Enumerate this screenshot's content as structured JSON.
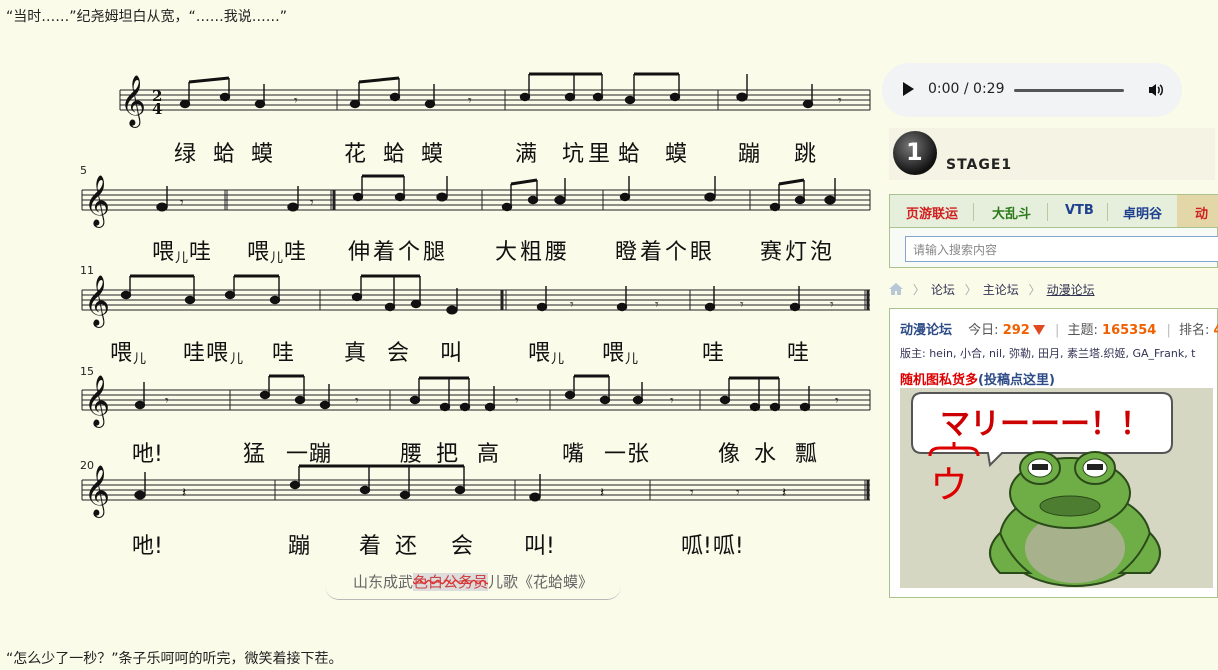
{
  "text": {
    "top_paragraph": "“当时……”纪尧姆坦白从宽，“……我说……”",
    "bottom_paragraph": "“怎么少了一秒？”条子乐呵呵的听完，微笑着接下茬。"
  },
  "score": {
    "time_signature_top": "2",
    "time_signature_bottom": "4",
    "measure_numbers": [
      "5",
      "11",
      "15",
      "20"
    ],
    "lyrics": {
      "row1": [
        "绿",
        "蛤",
        "蟆",
        "花",
        "蛤",
        "蟆",
        "满",
        "坑",
        "里",
        "蛤",
        "蟆",
        "蹦",
        "跳"
      ],
      "row2": [
        "喂",
        "儿",
        "哇",
        "喂",
        "儿",
        "哇",
        "伸 着 个 腿",
        "大 粗 腰",
        "瞪 着 个 眼",
        "赛 灯 泡"
      ],
      "row3": [
        "喂",
        "儿",
        "哇 喂",
        "儿",
        "哇",
        "真",
        "会",
        "叫",
        "喂",
        "儿",
        "喂",
        "儿",
        "哇",
        "哇"
      ],
      "row4": [
        "吔!",
        "猛",
        "一 蹦",
        "腰",
        "把",
        "高",
        "嘴",
        "一 张",
        "像",
        "水",
        "瓢"
      ],
      "row5": [
        "吔!",
        "蹦",
        "着",
        "还",
        "会",
        "叫!",
        "呱! 呱!"
      ]
    },
    "caption": {
      "prefix": "山东成武",
      "struck": "色白公务员",
      "suffix": "儿歌《花蛤蟆》"
    }
  },
  "audio": {
    "time": "0:00 / 0:29"
  },
  "sidebar": {
    "logo_text": "STAGE1",
    "logo_digit": "1",
    "tabs": [
      "页游联运",
      "大乱斗",
      "VTB",
      "卓明谷",
      "动"
    ],
    "tab_colors": [
      "#d02020",
      "#2a7a1a",
      "#1f3f8f",
      "#1f3f8f",
      "#d02020"
    ],
    "search_placeholder": "请输入搜索内容",
    "breadcrumb": [
      "论坛",
      "主论坛",
      "动漫论坛"
    ],
    "forum": {
      "name": "动漫论坛",
      "today_label": "今日:",
      "today_value": "292",
      "topics_label": "主题:",
      "topics_value": "165354",
      "rank_label": "排名:",
      "rank_value": "4",
      "moderators": "版主: hein, 小合, nil, 弥勒, 田月, 素兰塔.织姬, GA_Frank, t",
      "random_text": "随机图私货多",
      "random_link": "(投稿点这里)",
      "image_bubble_text": "マリーーー！！",
      "image_annot_text": "ウ"
    }
  }
}
